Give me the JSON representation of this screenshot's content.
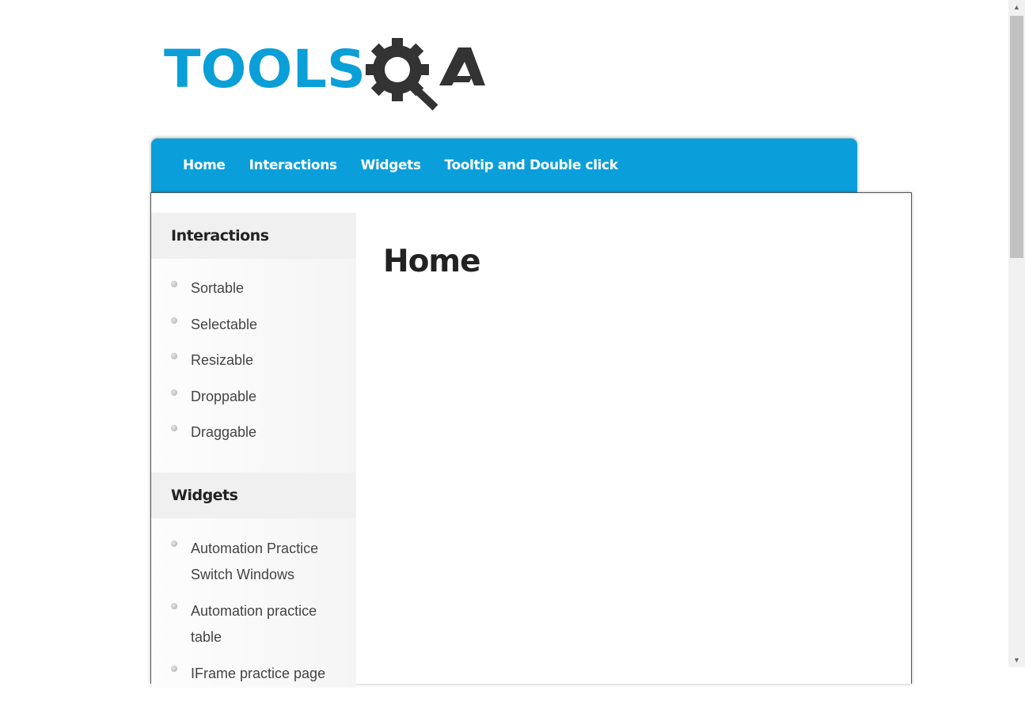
{
  "logo": {
    "text_tools": "TOOLS",
    "text_qa": "QA"
  },
  "nav": {
    "items": [
      "Home",
      "Interactions",
      "Widgets",
      "Tooltip and Double click"
    ]
  },
  "sidebar": {
    "sections": [
      {
        "heading": "Interactions",
        "items": [
          "Sortable",
          "Selectable",
          "Resizable",
          "Droppable",
          "Draggable"
        ]
      },
      {
        "heading": "Widgets",
        "items": [
          "Automation Practice Switch Windows",
          "Automation practice table",
          "IFrame practice page"
        ]
      }
    ]
  },
  "main": {
    "title": "Home"
  },
  "colors": {
    "nav_bg": "#0a9fdb",
    "logo_blue": "#0b9fd8",
    "logo_dark": "#333333"
  },
  "scrollbar": {
    "up": "▲",
    "down": "▼"
  }
}
